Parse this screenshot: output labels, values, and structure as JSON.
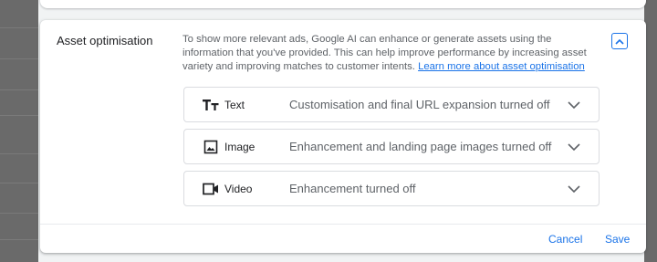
{
  "section": {
    "title": "Asset optimisation",
    "description": "To show more relevant ads, Google AI can enhance or generate assets using the information that you've provided. This can help improve performance by increasing asset variety and improving matches to customer intents.",
    "learn_more": "Learn more about asset optimisation",
    "collapse_icon": "chevron-up-icon"
  },
  "rows": [
    {
      "icon": "text-format-icon",
      "label": "Text",
      "status": "Customisation and final URL expansion turned off"
    },
    {
      "icon": "image-icon",
      "label": "Image",
      "status": "Enhancement and landing page images turned off"
    },
    {
      "icon": "video-camera-icon",
      "label": "Video",
      "status": "Enhancement turned off"
    }
  ],
  "footer": {
    "cancel_label": "Cancel",
    "save_label": "Save"
  },
  "colors": {
    "accent": "#1a73e8",
    "text_primary": "#202124",
    "text_secondary": "#5f6368",
    "border": "#dadce0"
  }
}
